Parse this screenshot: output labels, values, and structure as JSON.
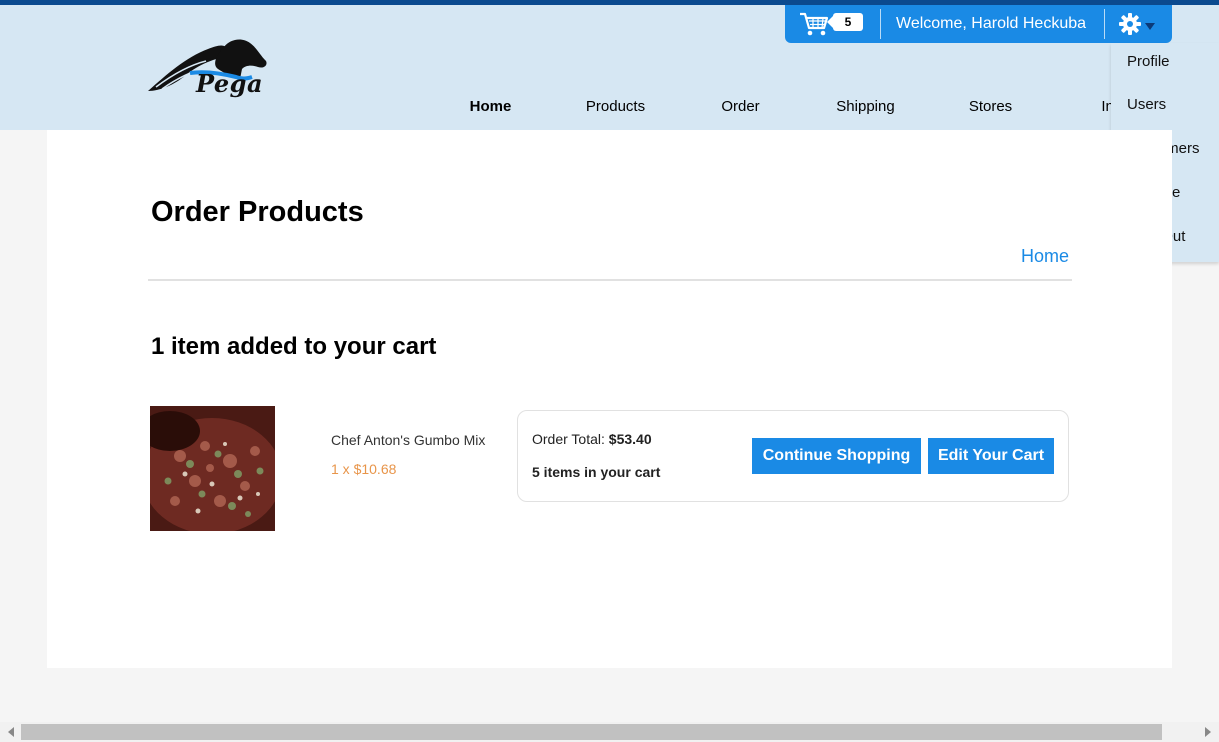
{
  "brand": {
    "logo_text": "Pega"
  },
  "utility": {
    "cart_count": "5",
    "welcome_text": "Welcome, Harold Heckuba",
    "accent_color": "#1a8ae5"
  },
  "nav": {
    "items": [
      "Home",
      "Products",
      "Order",
      "Shipping",
      "Stores",
      "Inve"
    ],
    "active": "Home"
  },
  "settings_menu": {
    "items": [
      "Profile",
      "Users",
      "Customers",
      "Finance",
      "Sign Out"
    ]
  },
  "page": {
    "title": "Order Products",
    "breadcrumb": "Home",
    "added_message": "1 item added to your cart"
  },
  "product": {
    "name": "Chef Anton's Gumbo Mix",
    "qty_price": "1 x $10.68"
  },
  "summary": {
    "total_label": "Order Total: ",
    "total_value": "$53.40",
    "items_text": "5 items in your cart",
    "continue_label": "Continue Shopping",
    "edit_label": "Edit Your Cart"
  }
}
